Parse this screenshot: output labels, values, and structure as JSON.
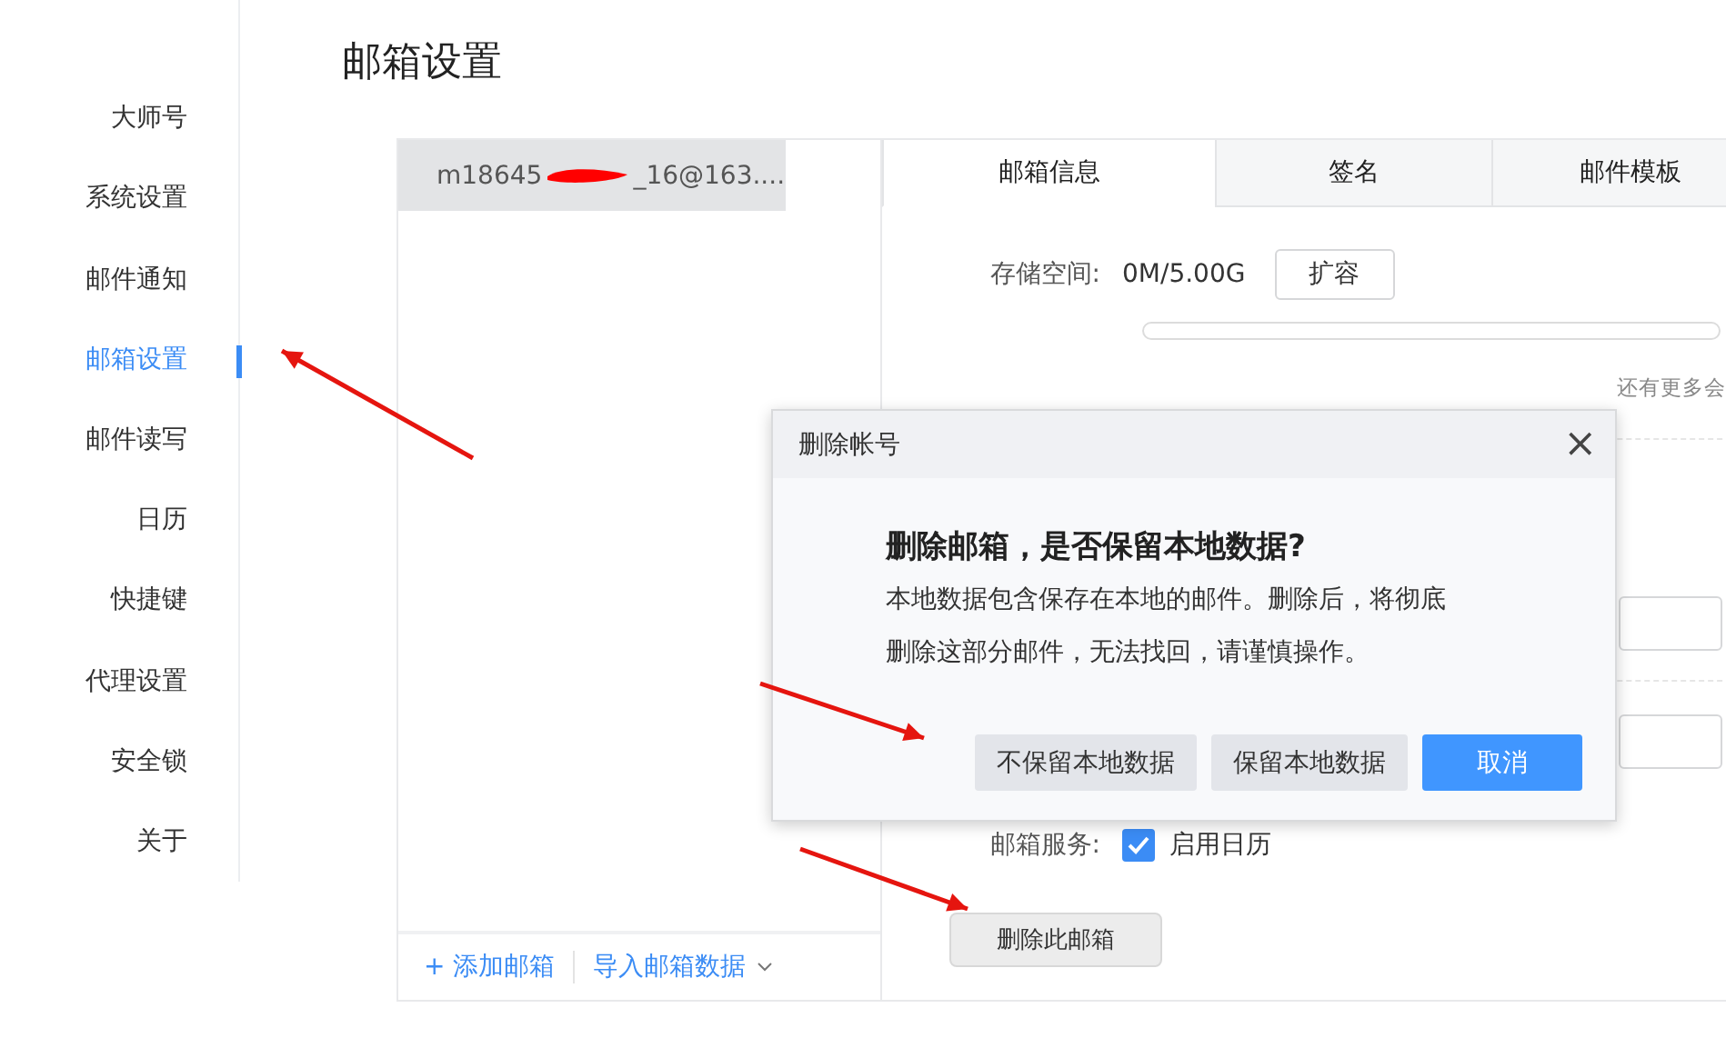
{
  "sidebar": {
    "items": [
      {
        "label": "大师号",
        "selected": false
      },
      {
        "label": "系统设置",
        "selected": false
      },
      {
        "label": "邮件通知",
        "selected": false
      },
      {
        "label": "邮箱设置",
        "selected": true
      },
      {
        "label": "邮件读写",
        "selected": false
      },
      {
        "label": "日历",
        "selected": false
      },
      {
        "label": "快捷键",
        "selected": false
      },
      {
        "label": "代理设置",
        "selected": false
      },
      {
        "label": "安全锁",
        "selected": false
      },
      {
        "label": "关于",
        "selected": false
      }
    ]
  },
  "page_title": "邮箱设置",
  "accounts": [
    {
      "label_start": "m18645",
      "label_end": "_16@163....",
      "redacted": true,
      "selected": true
    }
  ],
  "account_footer": {
    "add": "添加邮箱",
    "add_icon": "+",
    "import": "导入邮箱数据"
  },
  "tabs": [
    {
      "label": "邮箱信息",
      "selected": true
    },
    {
      "label": "签名",
      "selected": false
    },
    {
      "label": "邮件模板",
      "selected": false
    }
  ],
  "storage": {
    "label": "存储空间:",
    "value": "0M/5.00G",
    "button": "扩容",
    "level": 0,
    "hint": "还有更多会"
  },
  "service": {
    "label": "邮箱服务:",
    "option": "启用日历",
    "checked": true
  },
  "delete_button": "删除此邮箱",
  "dialog": {
    "title": "删除帐号",
    "close": "×",
    "heading": "删除邮箱，是否保留本地数据?",
    "message": "本地数据包含保存在本地的邮件。删除后，将彻底删除这部分邮件，无法找回，请谨慎操作。",
    "buttons": [
      {
        "label": "不保留本地数据",
        "kind": "secondary"
      },
      {
        "label": "保留本地数据",
        "kind": "secondary"
      },
      {
        "label": "取消",
        "kind": "primary"
      }
    ]
  }
}
